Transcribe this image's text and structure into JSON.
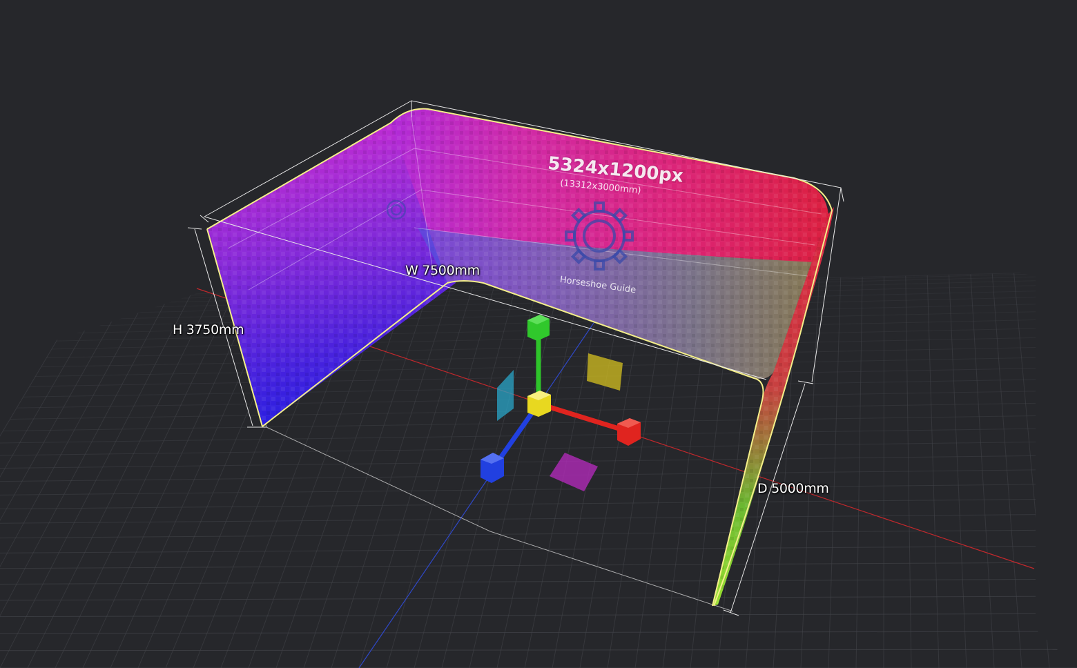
{
  "viewport": {
    "background": "#26272b",
    "grid_color": "#4a4c52",
    "axis_x_color": "#c0282c",
    "axis_z_color": "#2f48c8"
  },
  "dimensions": {
    "height_label": "H 3750mm",
    "width_label": "W 7500mm",
    "depth_label": "D 5000mm"
  },
  "screen": {
    "shape": "horseshoe",
    "resolution": "5324x1200px",
    "physical_size": "(13312x3000mm)",
    "guide_name": "Horseshoe Guide",
    "outline_color": "#f4ef8a",
    "watermark_icon": "gear-icon"
  },
  "gizmo": {
    "x_axis_color": "#e0241f",
    "y_axis_color": "#2ec42a",
    "z_axis_color": "#2140e0",
    "center_color": "#f0e020",
    "plane_xy_color": "#d4c020",
    "plane_yz_color": "#2aa6c8",
    "plane_xz_color": "#b02ab8",
    "icons": [
      "move-gizmo-icon"
    ]
  }
}
